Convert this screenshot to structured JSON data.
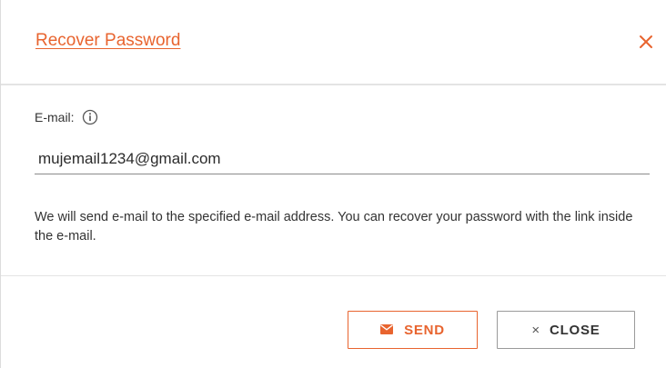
{
  "dialog": {
    "title": "Recover Password",
    "close_icon": "close-icon",
    "accent_color": "#e8642f"
  },
  "form": {
    "email_label": "E-mail:",
    "info_icon": "info-icon",
    "email_value": "mujemail1234@gmail.com",
    "info_text": "We will send e-mail to the specified e-mail address. You can recover your password with the link inside the e-mail."
  },
  "actions": {
    "send_label": "SEND",
    "send_icon": "envelope-icon",
    "close_label": "CLOSE",
    "close_icon_glyph": "×"
  }
}
